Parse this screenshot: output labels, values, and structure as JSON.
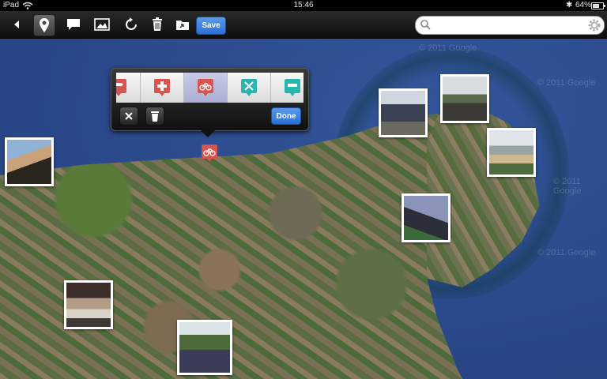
{
  "status": {
    "device": "iPad",
    "time": "15:46",
    "battery": "64%",
    "battery_level": 0.64
  },
  "toolbar": {
    "save_label": "Save",
    "search": {
      "placeholder": "",
      "value": ""
    }
  },
  "popover": {
    "done_label": "Done",
    "categories": [
      "signpost",
      "first-aid",
      "cycling",
      "tools",
      "parking"
    ],
    "selected": "cycling"
  },
  "map": {
    "copyright": "© 2011 Google"
  },
  "colors": {
    "accent_blue": "#2b6fd4",
    "marker_red": "#d9534f",
    "marker_teal": "#2bb5b0"
  }
}
